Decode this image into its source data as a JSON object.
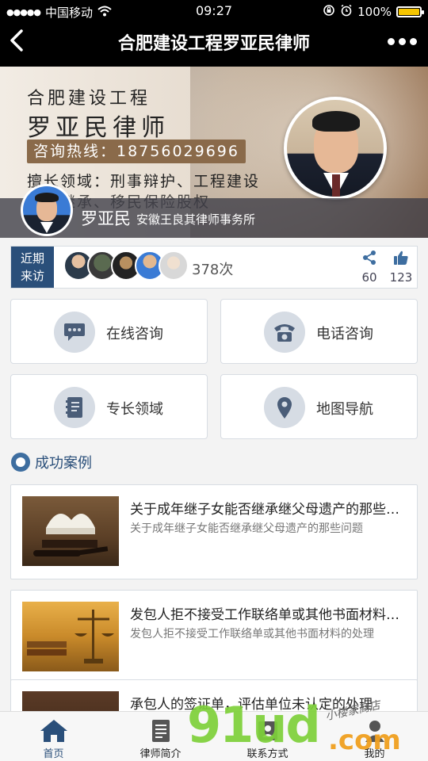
{
  "status_bar": {
    "carrier": "中国移动",
    "time": "09:27",
    "battery": "100%",
    "battery_level": 1.0
  },
  "nav": {
    "title": "合肥建设工程罗亚民律师"
  },
  "banner": {
    "line1": "合肥建设工程",
    "line2": "罗亚民律师",
    "hotline": "咨询热线：18756029696",
    "specialty_line1": "擅长领域：刑事辩护、工程建设",
    "specialty_line2": "遗产继承、移民保险股权"
  },
  "profile": {
    "name": "罗亚民",
    "firm": "安徽王良其律师事务所"
  },
  "visitors": {
    "tag_line1": "近期",
    "tag_line2": "来访",
    "count": "378次",
    "shares": "60",
    "likes": "123"
  },
  "tiles": {
    "online": "在线咨询",
    "phone": "电话咨询",
    "specialty": "专长领域",
    "map": "地图导航"
  },
  "cases_section": {
    "title": "成功案例"
  },
  "cases": [
    {
      "title": "关于成年继子女能否继承继父母遗产的那些问题",
      "summary": "关于成年继子女能否继承继父母遗产的那些问题"
    },
    {
      "title": "发包人拒不接受工作联络单或其他书面材料的处理",
      "summary": "发包人拒不接受工作联络单或其他书面材料的处理"
    },
    {
      "title": "承包人的签证单，评估单位未认定的处理",
      "summary": ""
    }
  ],
  "tabbar": {
    "home": "首页",
    "profile": "律师简介",
    "contact": "联系方式",
    "mine": "我的"
  },
  "watermark": {
    "brand": "91ud",
    "suffix": ".com",
    "cursive": "小楼家商店"
  },
  "colors": {
    "accent": "#2a4f7a",
    "icon_blue": "#3e6ea0",
    "watermark_green": "#7ed13a",
    "watermark_orange": "#f0a020"
  }
}
